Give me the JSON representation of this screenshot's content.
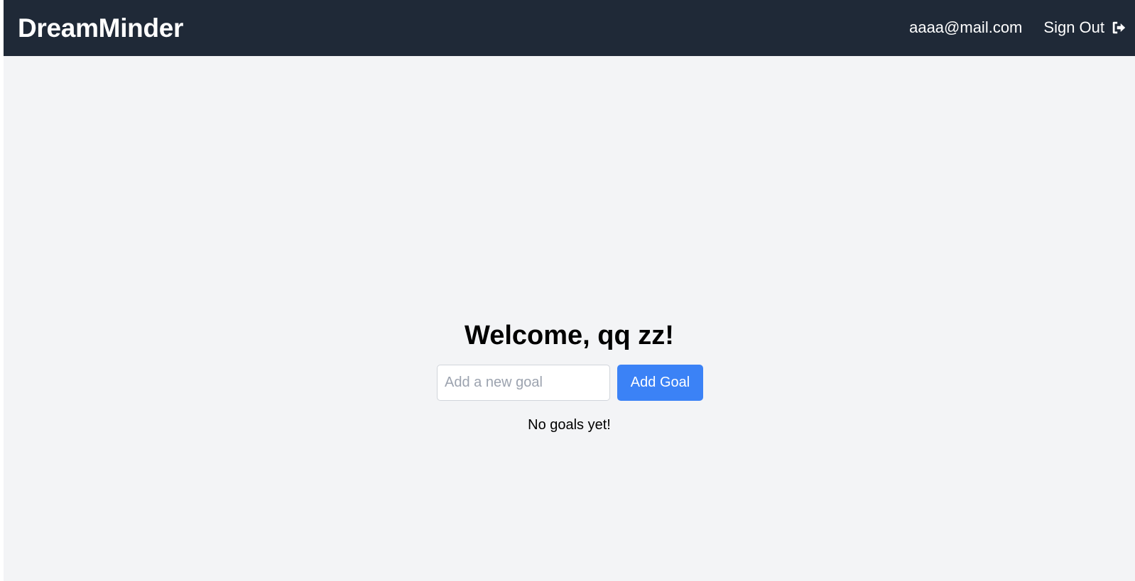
{
  "app": {
    "brand": "DreamMinder"
  },
  "header": {
    "user_email": "aaaa@mail.com",
    "sign_out_label": "Sign Out",
    "sign_out_icon": "sign-out-icon"
  },
  "main": {
    "welcome": "Welcome, qq zz!",
    "goal_input": {
      "placeholder": "Add a new goal",
      "value": ""
    },
    "add_button_label": "Add Goal",
    "empty_message": "No goals yet!"
  },
  "colors": {
    "navbar": "#1f2937",
    "background": "#f3f4f6",
    "accent": "#3b82f6"
  }
}
